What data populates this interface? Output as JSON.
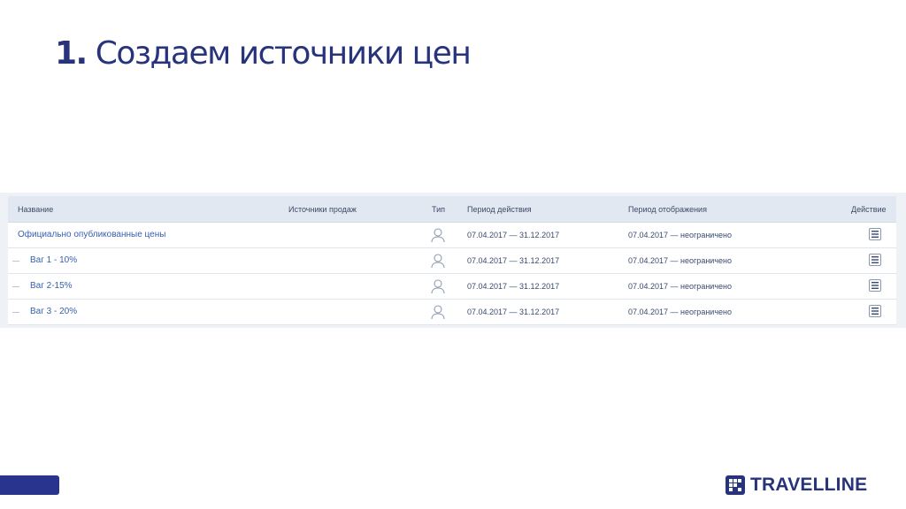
{
  "slide": {
    "title_number": "1.",
    "title_text": "Создаем источники цен"
  },
  "table": {
    "headers": {
      "name": "Название",
      "sources": "Источники продаж",
      "type": "Тип",
      "valid_period": "Период действия",
      "display_period": "Период отображения",
      "action": "Действие"
    },
    "rows": [
      {
        "name": "Официально опубликованные цены",
        "valid_period": "07.04.2017 — 31.12.2017",
        "display_period": "07.04.2017 — неограничено",
        "type_icon": "user-icon",
        "action_icon": "menu-icon"
      },
      {
        "name": "Ваг 1 - 10%",
        "valid_period": "07.04.2017 — 31.12.2017",
        "display_period": "07.04.2017 — неограничено",
        "type_icon": "user-icon",
        "action_icon": "menu-icon"
      },
      {
        "name": "Ваг 2-15%",
        "valid_period": "07.04.2017 — 31.12.2017",
        "display_period": "07.04.2017 — неограничено",
        "type_icon": "user-icon",
        "action_icon": "menu-icon"
      },
      {
        "name": "Ваг 3 - 20%",
        "valid_period": "07.04.2017 — 31.12.2017",
        "display_period": "07.04.2017 — неограничено",
        "type_icon": "user-icon",
        "action_icon": "menu-icon"
      }
    ]
  },
  "branding": {
    "logo_text": "TRAVELLINE",
    "accent_color": "#27337a",
    "link_color": "#3760b0"
  }
}
